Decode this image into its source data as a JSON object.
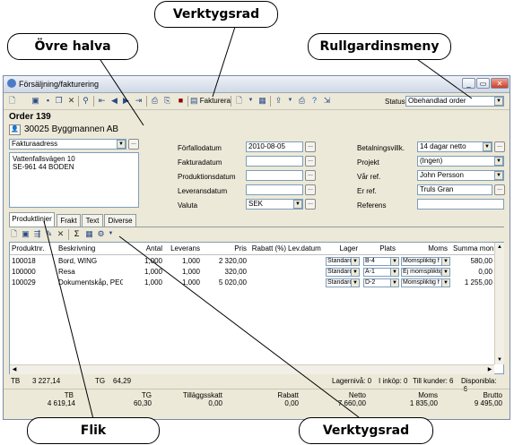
{
  "callouts": {
    "verktygsrad_top": "Verktygsrad",
    "ovre_halva": "Övre halva",
    "rullgardinsmeny": "Rullgardinsmeny",
    "flik": "Flik",
    "verktygsrad_bottom": "Verktygsrad"
  },
  "window": {
    "title": "Försäljning/fakturering",
    "toolbar": {
      "fakturera_label": "Fakturera",
      "status_label": "Status",
      "status_value": "Obehandlad order"
    }
  },
  "order": {
    "title": "Order 139",
    "customer": "30025 Byggmannen AB",
    "address_type": "Fakturaadress",
    "address_lines": [
      "Vattenfallsvägen 10",
      "SE-961 44 BODEN"
    ]
  },
  "dates": {
    "forfallodatum_label": "Förfallodatum",
    "forfallodatum_value": "2010-08-05",
    "fakturadatum_label": "Fakturadatum",
    "produktionsdatum_label": "Produktionsdatum",
    "leveransdatum_label": "Leveransdatum",
    "valuta_label": "Valuta",
    "valuta_value": "SEK"
  },
  "terms": {
    "betalningsvillk_label": "Betalningsvillk.",
    "betalningsvillk_value": "14 dagar netto",
    "projekt_label": "Projekt",
    "projekt_value": "(Ingen)",
    "var_ref_label": "Vår ref.",
    "var_ref_value": "John Persson",
    "er_ref_label": "Er ref.",
    "er_ref_value": "Truls Gran",
    "referens_label": "Referens"
  },
  "tabs": [
    "Produktlinjer",
    "Frakt",
    "Text",
    "Diverse"
  ],
  "grid": {
    "columns": [
      "Produktnr.",
      "Beskrivning",
      "Antal",
      "Leverans",
      "Pris",
      "Rabatt (%)",
      "Lev.datum",
      "Lager",
      "Plats",
      "Moms",
      "Summa mon"
    ],
    "rows": [
      {
        "nr": "100018",
        "desc": "Bord, WING",
        "antal": "1,000",
        "lev": "1,000",
        "pris": "2 320,00",
        "lager": "Standard",
        "plats": "B-4",
        "moms": "Momspliktig f",
        "summa": "580,00"
      },
      {
        "nr": "100000",
        "desc": "Resa",
        "antal": "1,000",
        "lev": "1,000",
        "pris": "320,00",
        "lager": "Standard",
        "plats": "A-1",
        "moms": "Ej momspliktig",
        "summa": "0,00"
      },
      {
        "nr": "100029",
        "desc": "Dokumentskåp, PEG",
        "antal": "1,000",
        "lev": "1,000",
        "pris": "5 020,00",
        "lager": "Standard",
        "plats": "D-2",
        "moms": "Momspliktig f",
        "summa": "1 255,00"
      }
    ]
  },
  "statusline": {
    "tb": "TB",
    "tb_value": "3 227,14",
    "tg": "TG",
    "tg_value": "64,29",
    "lagerniva": "Lagernivå: 0",
    "i_inkop": "I inköp: 0",
    "till_kunder": "Till kunder: 6",
    "disponibla": "Disponibla: -6"
  },
  "totals": [
    {
      "label": "TB",
      "value": "4 619,14"
    },
    {
      "label": "TG",
      "value": "60,30"
    },
    {
      "label": "Tilläggsskatt",
      "value": "0,00"
    },
    {
      "label": "Rabatt",
      "value": "0,00"
    },
    {
      "label": "Netto",
      "value": "7 660,00"
    },
    {
      "label": "Moms",
      "value": "1 835,00"
    },
    {
      "label": "Brutto",
      "value": "9 495,00"
    }
  ]
}
